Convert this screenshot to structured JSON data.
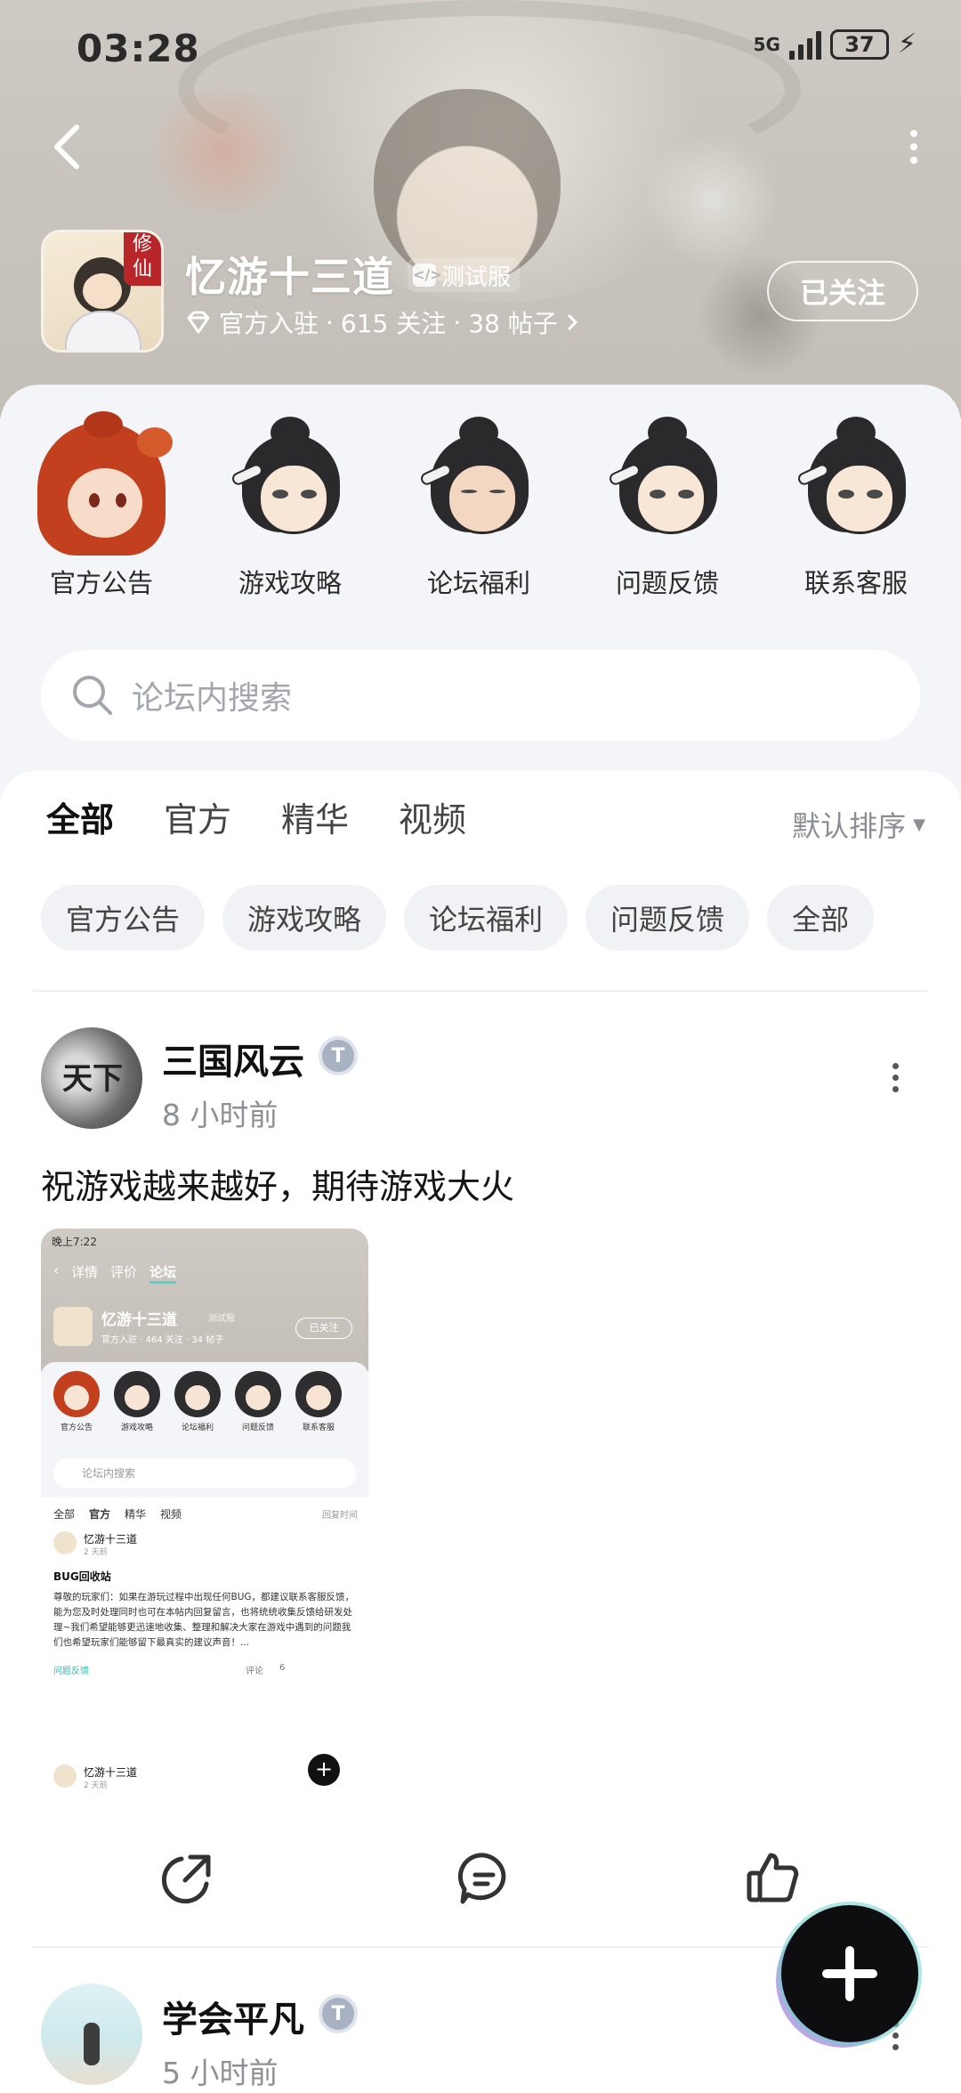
{
  "status_bar": {
    "time": "03:28",
    "network": "5G",
    "battery": "37"
  },
  "game": {
    "logo_tag": "修仙",
    "title": "忆游十三道",
    "test_badge": "测试服",
    "verified_label": "官方入驻",
    "follows": "615 关注",
    "posts": "38 帖子",
    "separator": "·",
    "follow_button": "已关注"
  },
  "quick_links": [
    {
      "label": "官方公告"
    },
    {
      "label": "游戏攻略"
    },
    {
      "label": "论坛福利"
    },
    {
      "label": "问题反馈"
    },
    {
      "label": "联系客服"
    }
  ],
  "search": {
    "placeholder": "论坛内搜索"
  },
  "tabs": [
    "全部",
    "官方",
    "精华",
    "视频"
  ],
  "sort": {
    "label": "默认排序"
  },
  "chips": [
    "官方公告",
    "游戏攻略",
    "论坛福利",
    "问题反馈",
    "全部"
  ],
  "posts": [
    {
      "author": "三国风云",
      "avatar_text": "天下",
      "time": "8 小时前",
      "text": "祝游戏越来越好，期待游戏大火",
      "screenshot": {
        "time": "晚上7:22",
        "nav": [
          "详情",
          "评价",
          "论坛"
        ],
        "title": "忆游十三道",
        "badge": "测试服",
        "meta": "官方入驻 · 464 关注 · 34 帖子",
        "follow": "已关注",
        "quick": [
          "官方公告",
          "游戏攻略",
          "论坛福利",
          "问题反馈",
          "联系客服"
        ],
        "search": "论坛内搜索",
        "tabs": [
          "全部",
          "官方",
          "精华",
          "视频"
        ],
        "sort": "回复时间",
        "post_author": "忆游十三道",
        "post_time": "2 天前",
        "post_title": "BUG回收站",
        "post_body": "尊敬的玩家们：如果在游玩过程中出现任何BUG，都建议联系客服反馈，能为您及时处理同时也可在本帖内回复留言，也将统统收集反馈给研发处理~我们希望能够更迅速地收集、整理和解决大家在游戏中遇到的问题我们也希望玩家们能够留下最真实的建议声音！...",
        "post_tag": "问题反馈",
        "comment": "评论",
        "likes": "6",
        "post2_author": "忆游十三道",
        "post2_time": "2 天前"
      }
    },
    {
      "author": "学会平凡",
      "time": "5 小时前"
    }
  ],
  "colors": {
    "accent": "#4fd6c8",
    "header_bg": "#c9c4bd",
    "panel_bg": "#f4f5f8"
  }
}
